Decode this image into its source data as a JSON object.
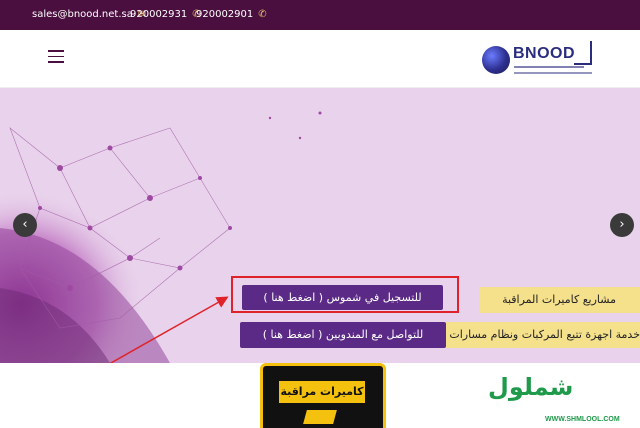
{
  "topbar": {
    "email": "sales@bnood.net.sa",
    "phone_1": "920002931",
    "phone_2": "920002901"
  },
  "header": {
    "logo_text": "BNOOD"
  },
  "hero": {
    "cta_register": "للتسجيل في شموس ( اضغط هنا )",
    "cta_contact": "للتواصل مع المندوبين ( اضغط هنا )",
    "banner_projects": "مشاريع كاميرات المراقبة",
    "banner_tracking": "خدمة اجهزة تتبع المركبات ونظام مسارات"
  },
  "bottom": {
    "camera_label": "كاميرات مراقبة",
    "watermark": "شملول",
    "watermark_url": "WWW.SHMLOOL.COM"
  },
  "colors": {
    "topbar": "#4b0f3f",
    "cta": "#5b2a86",
    "banner": "#f5e08c",
    "highlight": "#e0232a",
    "hero_bg": "#e9d3ec"
  }
}
